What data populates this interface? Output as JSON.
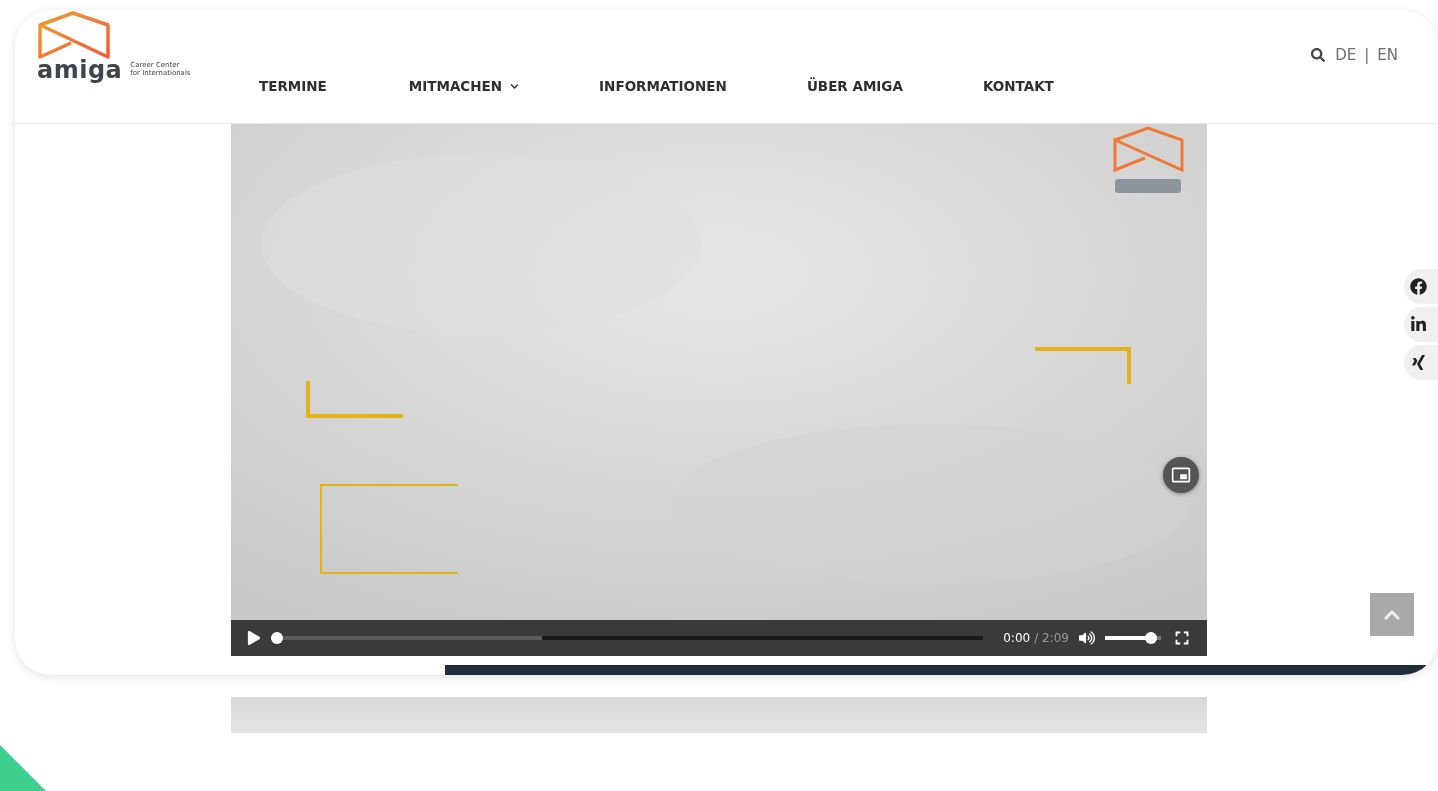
{
  "header": {
    "logo": {
      "name": "amiga",
      "tagline_lines": [
        "Career Center",
        "for Internationals"
      ]
    },
    "nav": [
      {
        "label": "TERMINE",
        "has_submenu": false
      },
      {
        "label": "MITMACHEN",
        "has_submenu": true
      },
      {
        "label": "INFORMATIONEN",
        "has_submenu": false
      },
      {
        "label": "ÜBER AMIGA",
        "has_submenu": false
      },
      {
        "label": "KONTAKT",
        "has_submenu": false
      }
    ],
    "languages": [
      "DE",
      "EN"
    ],
    "separator": "|"
  },
  "video": {
    "kind": "picture",
    "controls": {
      "playing": false,
      "progress": {
        "level": 0
      },
      "buffered": {
        "level": 0.38
      },
      "current_time": "0:00",
      "duration": "/ 2:09",
      "muted": false,
      "volume": {
        "level": 0.9
      }
    }
  },
  "social": [
    {
      "kind": "facebook"
    },
    {
      "kind": "linkedin"
    },
    {
      "kind": "xing"
    }
  ]
}
